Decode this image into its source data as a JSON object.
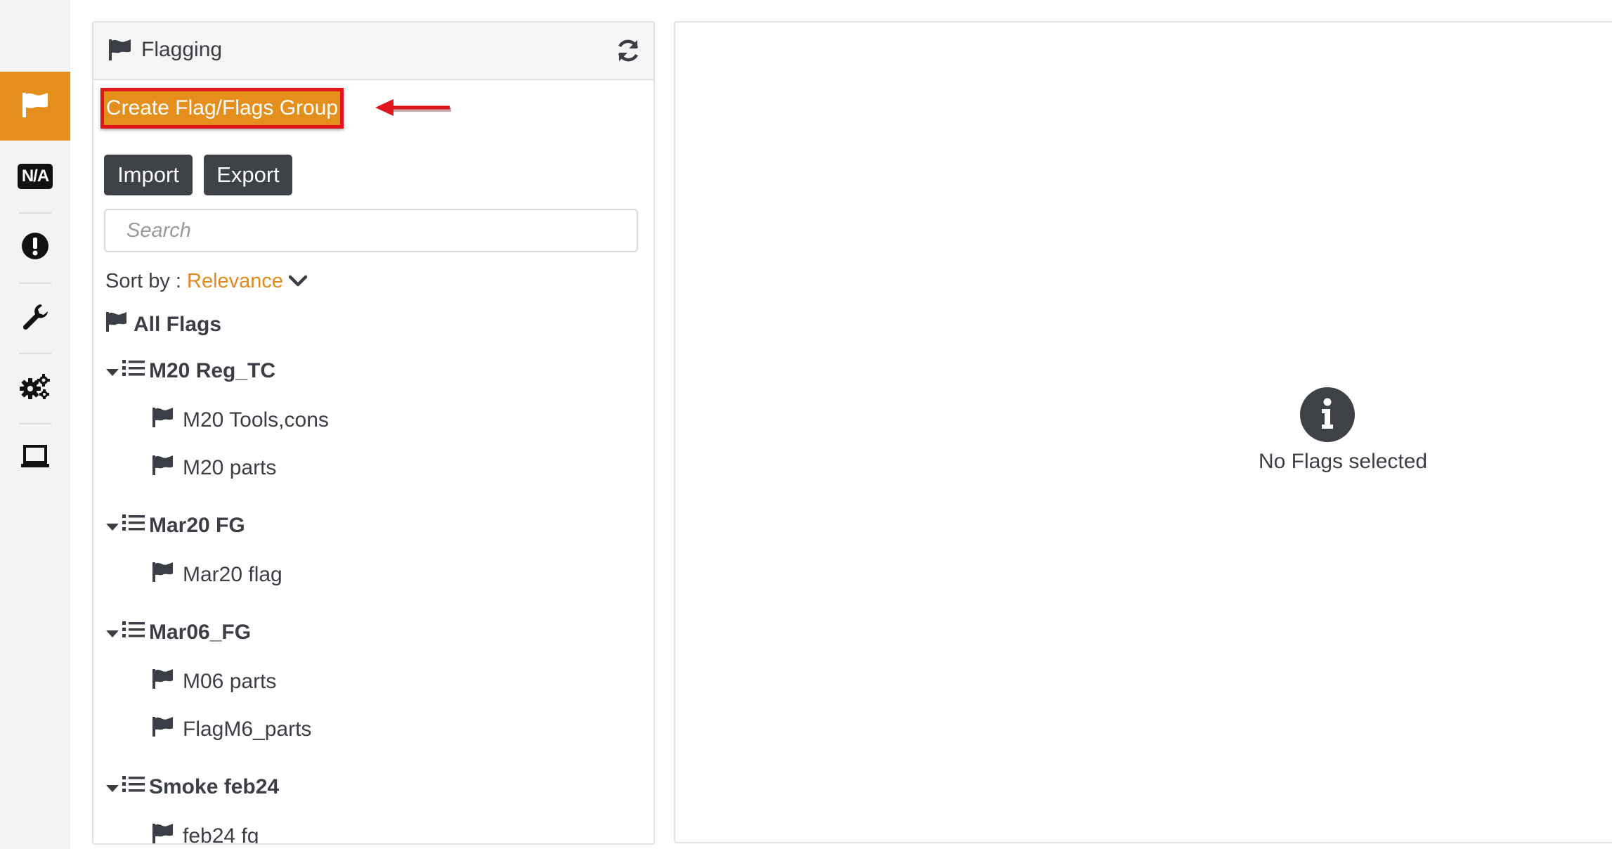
{
  "sidebar": {
    "items": [
      {
        "icon": "flag-icon",
        "active": true
      },
      {
        "icon": "na-icon",
        "label": "N/A"
      },
      {
        "icon": "exclamation-circle-icon"
      },
      {
        "icon": "wrench-icon"
      },
      {
        "icon": "gears-icon"
      },
      {
        "icon": "laptop-icon"
      }
    ]
  },
  "panel": {
    "title": "Flagging",
    "create_button": "Create Flag/Flags Group",
    "import_button": "Import",
    "export_button": "Export",
    "search_placeholder": "Search",
    "sort_label": "Sort by :",
    "sort_value": "Relevance",
    "all_flags": "All Flags",
    "groups": [
      {
        "name": "M20 Reg_TC",
        "flags": [
          "M20 Tools,cons",
          "M20 parts"
        ]
      },
      {
        "name": "Mar20 FG",
        "flags": [
          "Mar20 flag"
        ]
      },
      {
        "name": "Mar06_FG",
        "flags": [
          "M06 parts",
          "FlagM6_parts"
        ]
      },
      {
        "name": "Smoke feb24",
        "flags": [
          "feb24 fg"
        ]
      }
    ]
  },
  "details": {
    "empty_message": "No Flags selected"
  },
  "colors": {
    "accent": "#e48e1c",
    "annotation": "#e1161d",
    "dark_button": "#3e4146",
    "text": "#3b3f45"
  }
}
